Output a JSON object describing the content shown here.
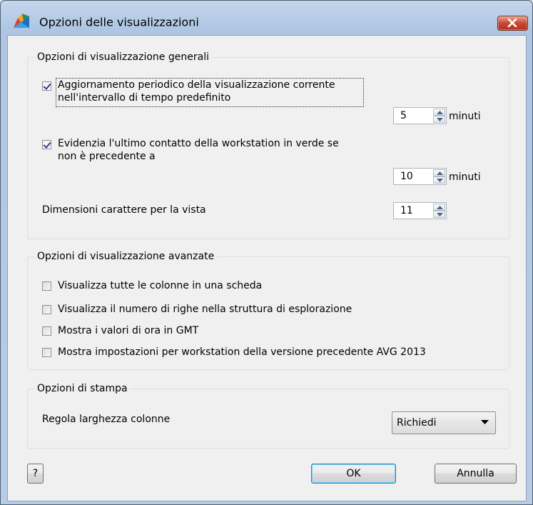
{
  "window": {
    "title": "Opzioni delle visualizzazioni"
  },
  "general": {
    "label": "Opzioni di visualizzazione generali",
    "periodic_refresh": {
      "label_line1": "Aggiornamento periodico della visualizzazione corrente",
      "label_line2": "nell'intervallo di tempo predefinito",
      "checked": true,
      "value": "5",
      "unit": "minuti"
    },
    "highlight_last_contact": {
      "label_line1": "Evidenzia l'ultimo contatto della workstation in verde se",
      "label_line2": "non è precedente a",
      "checked": true,
      "value": "10",
      "unit": "minuti"
    },
    "font_size": {
      "label": "Dimensioni carattere per la vista",
      "value": "11"
    }
  },
  "advanced": {
    "label": "Opzioni di visualizzazione avanzate",
    "options": [
      {
        "label": "Visualizza tutte le colonne in una scheda",
        "checked": false
      },
      {
        "label": "Visualizza il numero di righe nella struttura di esplorazione",
        "checked": false
      },
      {
        "label": "Mostra i valori di ora in GMT",
        "checked": false
      },
      {
        "label": "Mostra impostazioni per workstation della versione precedente AVG 2013",
        "checked": false
      }
    ]
  },
  "print": {
    "label": "Opzioni di stampa",
    "column_width": {
      "label": "Regola larghezza colonne",
      "selected": "Richiedi"
    }
  },
  "buttons": {
    "help": "?",
    "ok": "OK",
    "cancel": "Annulla"
  },
  "colors": {
    "title_bar": "#b7cde6",
    "dialog_bg": "#f0f0f0",
    "close_button": "#c74a34",
    "check_mark": "#27408b"
  }
}
